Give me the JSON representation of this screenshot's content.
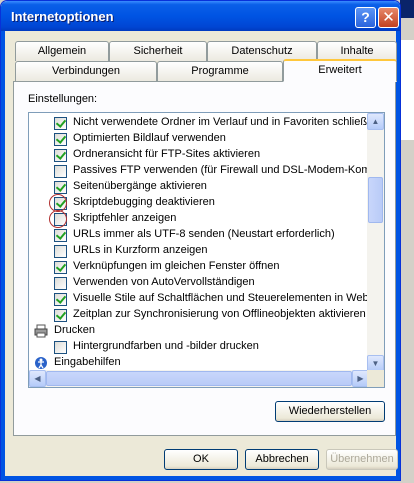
{
  "window": {
    "title": "Internetoptionen",
    "help_label": "?",
    "close_label": "✕"
  },
  "tabs": {
    "row1": [
      "Allgemein",
      "Sicherheit",
      "Datenschutz",
      "Inhalte"
    ],
    "row2": [
      "Verbindungen",
      "Programme",
      "Erweitert"
    ],
    "active": "Erweitert"
  },
  "settings": {
    "label": "Einstellungen:",
    "items": [
      {
        "type": "checkbox",
        "checked": true,
        "label": "Nicht verwendete Ordner im Verlauf und in Favoriten schließen"
      },
      {
        "type": "checkbox",
        "checked": true,
        "label": "Optimierten Bildlauf verwenden"
      },
      {
        "type": "checkbox",
        "checked": true,
        "label": "Ordneransicht für FTP-Sites aktivieren"
      },
      {
        "type": "checkbox",
        "checked": false,
        "label": "Passives FTP verwenden (für Firewall und DSL-Modem-Kompatibilität)"
      },
      {
        "type": "checkbox",
        "checked": true,
        "label": "Seitenübergänge aktivieren"
      },
      {
        "type": "checkbox",
        "checked": true,
        "label": "Skriptdebugging deaktivieren"
      },
      {
        "type": "checkbox",
        "checked": false,
        "label": "Skriptfehler anzeigen"
      },
      {
        "type": "checkbox",
        "checked": true,
        "label": "URLs immer als UTF-8 senden (Neustart erforderlich)"
      },
      {
        "type": "checkbox",
        "checked": false,
        "label": "URLs in Kurzform anzeigen"
      },
      {
        "type": "checkbox",
        "checked": true,
        "label": "Verknüpfungen im gleichen Fenster öffnen"
      },
      {
        "type": "checkbox",
        "checked": false,
        "label": "Verwenden von AutoVervollständigen"
      },
      {
        "type": "checkbox",
        "checked": true,
        "label": "Visuelle Stile auf Schaltflächen und Steuerelementen in Webseiten aktivieren"
      },
      {
        "type": "checkbox",
        "checked": true,
        "label": "Zeitplan zur Synchronisierung von Offlineobjekten aktivieren"
      },
      {
        "type": "group",
        "icon": "printer-icon",
        "label": "Drucken"
      },
      {
        "type": "checkbox",
        "checked": false,
        "label": "Hintergrundfarben und -bilder drucken"
      },
      {
        "type": "group",
        "icon": "accessibility-icon",
        "label": "Eingabehilfen"
      }
    ]
  },
  "buttons": {
    "restore": "Wiederherstellen",
    "ok": "OK",
    "cancel": "Abbrechen",
    "apply": "Übernehmen"
  },
  "scroll": {
    "up": "▲",
    "down": "▼",
    "left": "◀",
    "right": "▶"
  }
}
